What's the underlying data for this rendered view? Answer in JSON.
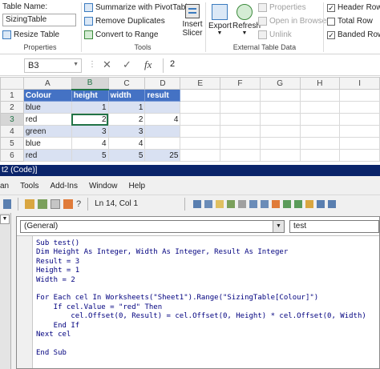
{
  "ribbon": {
    "table_name_label": "Table Name:",
    "table_name_value": "SizingTable",
    "resize_table": "Resize Table",
    "properties_group": "Properties",
    "summarize_pivot": "Summarize with PivotTable",
    "remove_duplicates": "Remove Duplicates",
    "convert_to_range": "Convert to Range",
    "tools_group": "Tools",
    "insert_slicer_line1": "Insert",
    "insert_slicer_line2": "Slicer",
    "export": "Export",
    "refresh": "Refresh",
    "properties": "Properties",
    "open_in_browser": "Open in Browser",
    "unlink": "Unlink",
    "external_group": "External Table Data",
    "header_row": "Header Row",
    "total_row": "Total Row",
    "banded_rows": "Banded Rows"
  },
  "formula_bar": {
    "name_box": "B3",
    "fx": "fx",
    "cancel": "✕",
    "enter": "✓",
    "value": "2"
  },
  "sheet": {
    "columns": [
      "A",
      "B",
      "C",
      "D",
      "E",
      "F",
      "G",
      "H",
      "I"
    ],
    "rows": [
      {
        "num": "1",
        "cells": [
          "Colour",
          "height",
          "width",
          "result"
        ]
      },
      {
        "num": "2",
        "cells": [
          "blue",
          "1",
          "1",
          ""
        ]
      },
      {
        "num": "3",
        "cells": [
          "red",
          "2",
          "2",
          "4"
        ]
      },
      {
        "num": "4",
        "cells": [
          "green",
          "3",
          "3",
          ""
        ]
      },
      {
        "num": "5",
        "cells": [
          "blue",
          "4",
          "4",
          ""
        ]
      },
      {
        "num": "6",
        "cells": [
          "red",
          "5",
          "5",
          "25"
        ]
      }
    ]
  },
  "vbe": {
    "title": "t2 (Code)]",
    "menu": [
      "an",
      "Tools",
      "Add-Ins",
      "Window",
      "Help"
    ],
    "position": "Ln 14, Col 1",
    "object_dropdown": "(General)",
    "proc_dropdown": "test",
    "code_lines": [
      "Sub test()",
      "Dim Height As Integer, Width As Integer, Result As Integer",
      "Result = 3",
      "Height = 1",
      "Width = 2",
      "",
      "For Each cel In Worksheets(\"Sheet1\").Range(\"SizingTable[Colour]\")",
      "    If cel.Value = \"red\" Then",
      "        cel.Offset(0, Result) = cel.Offset(0, Height) * cel.Offset(0, Width)",
      "    End If",
      "Next cel",
      "",
      "End Sub"
    ]
  },
  "colors": {
    "table_header": "#4472c4",
    "table_band": "#d9e1f2",
    "excel_green": "#217346",
    "vbe_title": "#0a246a",
    "code_keyword": "#00007f"
  }
}
